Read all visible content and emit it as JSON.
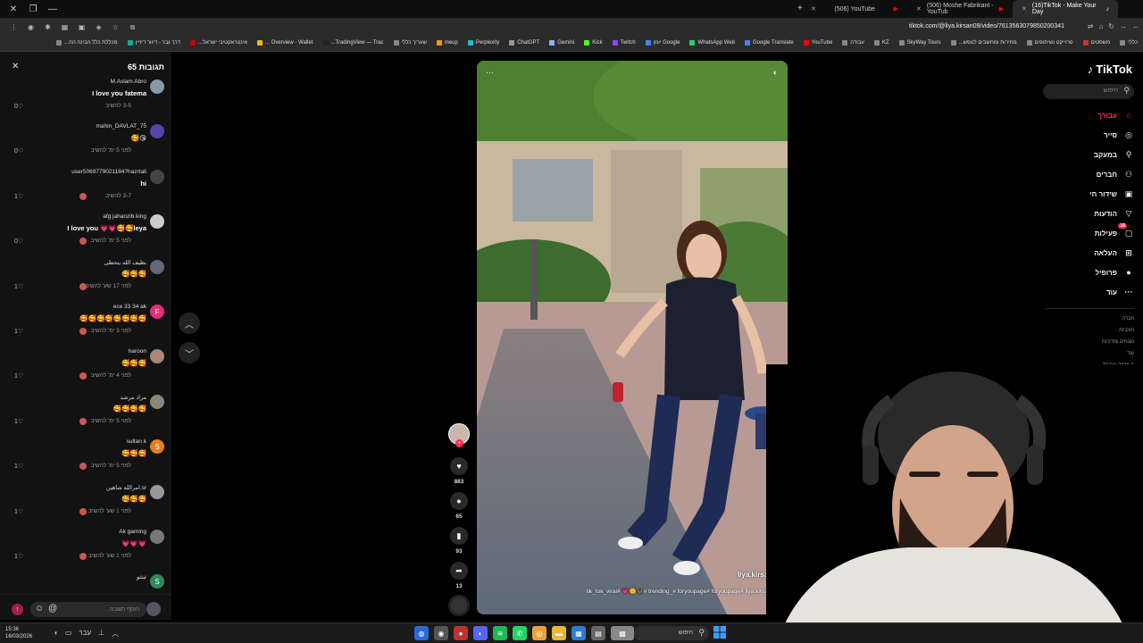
{
  "browser": {
    "tabs": [
      {
        "title": "(16)TikTok - Make Your Day",
        "active": true
      },
      {
        "title": "(506) Moshe Fabrikant - YouTub",
        "active": false
      },
      {
        "title": "(506) YouTube",
        "active": false
      }
    ],
    "url": "tiktok.com/@liya.kirsan09/video/7613563079850200341",
    "bookmarks": [
      {
        "label": "כללי",
        "color": "#888"
      },
      {
        "label": "משפטים",
        "color": "#c33"
      },
      {
        "label": "פרוייקט ושיתופים",
        "color": "#888"
      },
      {
        "label": "מחירות ומחשבים לנופש...",
        "color": "#888"
      },
      {
        "label": "SkyWay Tours",
        "color": "#888"
      },
      {
        "label": "KZ",
        "color": "#888"
      },
      {
        "label": "עבודה",
        "color": "#888"
      },
      {
        "label": "YouTube",
        "color": "#f00"
      },
      {
        "label": "Google Translate",
        "color": "#4285f4"
      },
      {
        "label": "WhatsApp Web",
        "color": "#25d366"
      },
      {
        "label": "Google יומן",
        "color": "#4285f4"
      },
      {
        "label": "Twitch",
        "color": "#9146ff"
      },
      {
        "label": "Kick",
        "color": "#53fc18"
      },
      {
        "label": "Gemini",
        "color": "#8ab4f8"
      },
      {
        "label": "ChatGPT",
        "color": "#999"
      },
      {
        "label": "Perplexity",
        "color": "#20b8cd"
      },
      {
        "label": "meup",
        "color": "#f7931a"
      },
      {
        "label": "שעריך כללי",
        "color": "#888"
      },
      {
        "label": "TradingView — Trac...",
        "color": "#222"
      },
      {
        "label": "Overview - Wallet ...",
        "color": "#f0b90b"
      },
      {
        "label": "אינטראקטיבי ישראל...",
        "color": "#c00"
      },
      {
        "label": "דרך גבר - דיוור דיזיין",
        "color": "#1a9"
      },
      {
        "label": "מכללת כלל הבינה הה...",
        "color": "#888"
      }
    ]
  },
  "comments": {
    "title": "תגובות 65",
    "reply_label": "להשיב",
    "input_placeholder": "הוסף תגובה...",
    "items": [
      {
        "user": "M.Aslam Abro",
        "text": "I love you fatema",
        "time": "3-5",
        "likes": "0",
        "avatar_color": "#8899aa",
        "avatar_letter": ""
      },
      {
        "user": "mahin_DAVLAT_75",
        "text": "🥰😘",
        "time": "לפני 5 ימ'",
        "likes": "0",
        "avatar_color": "#5544aa",
        "avatar_letter": ""
      },
      {
        "user": "user5069779021184?hazrtali",
        "text": "hi",
        "time": "3-7",
        "likes": "1",
        "avatar_color": "#444",
        "avatar_letter": ""
      },
      {
        "user": "afg jahanzib king",
        "text": "I love you 💗💗🥰🥰leya",
        "time": "לפני 5 ימ'",
        "likes": "0",
        "avatar_color": "#ccc",
        "avatar_letter": ""
      },
      {
        "user": "نظيف الله يتحطى",
        "text": "🥰🥰🥰",
        "time": "לפני 17 שע'",
        "likes": "1",
        "avatar_color": "#667",
        "avatar_letter": ""
      },
      {
        "user": "ece 33 34 ak",
        "text": "🥰🥰🥰🥰🥰🥰🥰🥰",
        "time": "לפני 3 ימ'",
        "likes": "1",
        "avatar_color": "#e0307a",
        "avatar_letter": "F"
      },
      {
        "user": "haroon",
        "text": "🥰🥰🥰",
        "time": "לפני 4 ימ'",
        "likes": "1",
        "avatar_color": "#a87",
        "avatar_letter": ""
      },
      {
        "user": "مراد مرشد",
        "text": "🥰🥰🥰🥰",
        "time": "לפני 5 ימ'",
        "likes": "1",
        "avatar_color": "#887",
        "avatar_letter": ""
      },
      {
        "user": "sultan k",
        "text": "🥰🥰🥰",
        "time": "לפני 5 ימ'",
        "likes": "1",
        "avatar_color": "#e67e22",
        "avatar_letter": "S"
      },
      {
        "user": "امرالله شاهين.sr",
        "text": "🥰🥰🥰",
        "time": "לפני 1 שע'",
        "likes": "1",
        "avatar_color": "#999",
        "avatar_letter": ""
      },
      {
        "user": "Ak gaming",
        "text": "💗💗💗",
        "time": "לפני 1 שע'",
        "likes": "1",
        "avatar_color": "#777",
        "avatar_letter": ""
      },
      {
        "user": "ثبثثو",
        "text": "",
        "time": "",
        "likes": "",
        "avatar_color": "#2e8b57",
        "avatar_letter": "S"
      }
    ]
  },
  "video": {
    "author": "liya.kirsan09",
    "tags": "tik_tok_viral# 💗🌼🦋# trending_# foryoupage# foryoupage# liya.kirsan יורה",
    "likes": "883",
    "comments": "65",
    "saves": "93",
    "shares": "13"
  },
  "sidebar": {
    "logo": "TikTok",
    "search_placeholder": "חיפוש",
    "nav": [
      {
        "label": "עבורך",
        "icon": "home-icon",
        "glyph": "⌂",
        "active": true
      },
      {
        "label": "סייר",
        "icon": "compass-icon",
        "glyph": "◎",
        "active": false
      },
      {
        "label": "במעקב",
        "icon": "following-icon",
        "glyph": "⚲",
        "active": false
      },
      {
        "label": "חברים",
        "icon": "friends-icon",
        "glyph": "⚇",
        "active": false
      },
      {
        "label": "שידור חי",
        "icon": "live-icon",
        "glyph": "▣",
        "active": false
      },
      {
        "label": "הודעות",
        "icon": "messages-icon",
        "glyph": "▽",
        "active": false
      },
      {
        "label": "פעילות",
        "icon": "activity-icon",
        "glyph": "▢",
        "active": false,
        "badge": "16"
      },
      {
        "label": "העלאה",
        "icon": "upload-icon",
        "glyph": "⊞",
        "active": false
      },
      {
        "label": "פרופיל",
        "icon": "profile-icon",
        "glyph": "●",
        "active": false
      },
      {
        "label": "עוד",
        "icon": "more-icon",
        "glyph": "···",
        "active": false
      }
    ],
    "footer": [
      "חברה",
      "תוכניות",
      "מונחים ומדיניות",
      "עוד",
      "© 2026 TikTok"
    ]
  },
  "taskbar": {
    "time": "15:36",
    "date": "16/03/2026",
    "search_placeholder": "חיפוש",
    "lang": "עבר"
  },
  "colors": {
    "accent": "#fe2c55",
    "panel": "#121212"
  }
}
